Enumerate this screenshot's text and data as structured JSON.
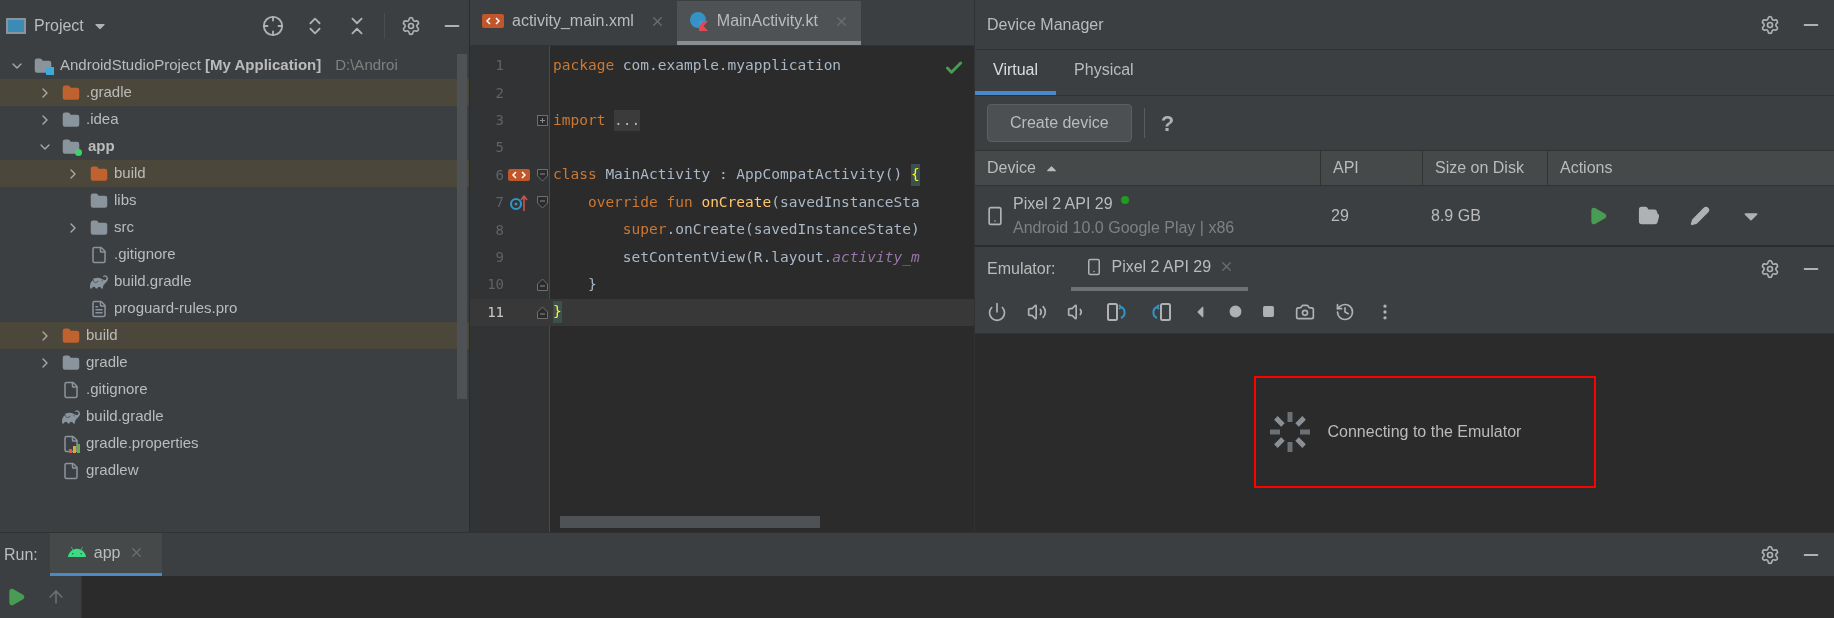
{
  "project_panel": {
    "title": "Project",
    "tree": [
      {
        "label": "AndroidStudioProject **[My Application]**",
        "path": "D:\\Androi",
        "kind": "module",
        "expanded": true,
        "children": [
          {
            "label": ".gradle",
            "kind": "excluded",
            "expanded": false
          },
          {
            "label": ".idea",
            "kind": "folder",
            "expanded": false
          },
          {
            "label": "app",
            "kind": "app-module",
            "bold": true,
            "expanded": true,
            "children": [
              {
                "label": "build",
                "kind": "excluded",
                "expanded": false
              },
              {
                "label": "libs",
                "kind": "folder"
              },
              {
                "label": "src",
                "kind": "folder",
                "expanded": false
              },
              {
                "label": ".gitignore",
                "kind": "ignore"
              },
              {
                "label": "build.gradle",
                "kind": "gradle"
              },
              {
                "label": "proguard-rules.pro",
                "kind": "text"
              }
            ]
          },
          {
            "label": "build",
            "kind": "excluded",
            "expanded": false
          },
          {
            "label": "gradle",
            "kind": "folder",
            "expanded": false
          },
          {
            "label": ".gitignore",
            "kind": "ignore"
          },
          {
            "label": "build.gradle",
            "kind": "gradle"
          },
          {
            "label": "gradle.properties",
            "kind": "properties"
          },
          {
            "label": "gradlew",
            "kind": "text-plain"
          }
        ]
      }
    ]
  },
  "editor": {
    "tabs": [
      {
        "label": "activity_main.xml",
        "kind": "xml",
        "selected": false
      },
      {
        "label": "MainActivity.kt",
        "kind": "kotlin",
        "selected": true
      }
    ],
    "lines": [
      {
        "number": "1",
        "selected": false,
        "tokens": [
          {
            "text": "package ",
            "kind": "keyword"
          },
          {
            "text": "com.example.myapplication",
            "kind": "plain"
          }
        ]
      },
      {
        "number": "2",
        "selected": false
      },
      {
        "number": "3",
        "selected": false,
        "fold_marker": {
          "kind": "collapsed"
        },
        "tokens": [
          {
            "text": "import ",
            "kind": "keyword"
          },
          {
            "text": "...",
            "kind": "folded"
          }
        ]
      },
      {
        "number": "5",
        "selected": false
      },
      {
        "number": "6",
        "selected": false,
        "gutter_icon": {
          "kind": "layout"
        },
        "fold_marker": {
          "kind": "open"
        },
        "tokens": [
          {
            "text": "class ",
            "kind": "keyword"
          },
          {
            "text": "MainActivity : AppCompatActivity() ",
            "kind": "plain"
          },
          {
            "text": "{",
            "kind": "brace"
          }
        ]
      },
      {
        "number": "7",
        "selected": false,
        "gutter_icon": {
          "kind": "override"
        },
        "fold_marker": {
          "kind": "open"
        },
        "tokens": [
          {
            "text": "    override fun ",
            "kind": "keyword"
          },
          {
            "text": "onCreate",
            "kind": "function"
          },
          {
            "text": "(savedInstanceSta",
            "kind": "plain"
          }
        ]
      },
      {
        "number": "8",
        "selected": false,
        "tokens": [
          {
            "text": "        super",
            "kind": "keyword"
          },
          {
            "text": ".onCreate(savedInstanceState)",
            "kind": "plain"
          }
        ]
      },
      {
        "number": "9",
        "selected": false,
        "tokens": [
          {
            "text": "        setContentView(R.layout.",
            "kind": "plain"
          },
          {
            "text": "activity_m",
            "kind": "field"
          }
        ]
      },
      {
        "number": "10",
        "selected": false,
        "fold_marker": {
          "kind": "end"
        },
        "tokens": [
          {
            "text": "    }",
            "kind": "plain"
          }
        ]
      },
      {
        "number": "11",
        "selected": true,
        "fold_marker": {
          "kind": "end"
        },
        "tokens": [
          {
            "text": "}",
            "kind": "brace"
          }
        ]
      }
    ]
  },
  "device_manager": {
    "title": "Device Manager",
    "tabs": [
      {
        "label": "Virtual",
        "selected": true
      },
      {
        "label": "Physical",
        "selected": false
      }
    ],
    "create_button": "Create device",
    "help": "?",
    "columns": [
      "Device",
      "API",
      "Size on Disk",
      "Actions"
    ],
    "rows": [
      {
        "name": "Pixel 2 API 29",
        "color": "#1e9e1e",
        "subtitle": "Android 10.0 Google Play | x86",
        "api": "29",
        "size": "8.9 GB"
      }
    ]
  },
  "emulator": {
    "label": "Emulator:",
    "tab": "Pixel 2 API 29",
    "message": "Connecting to the Emulator"
  },
  "run_bar": {
    "label": "Run:",
    "tab": "app"
  }
}
